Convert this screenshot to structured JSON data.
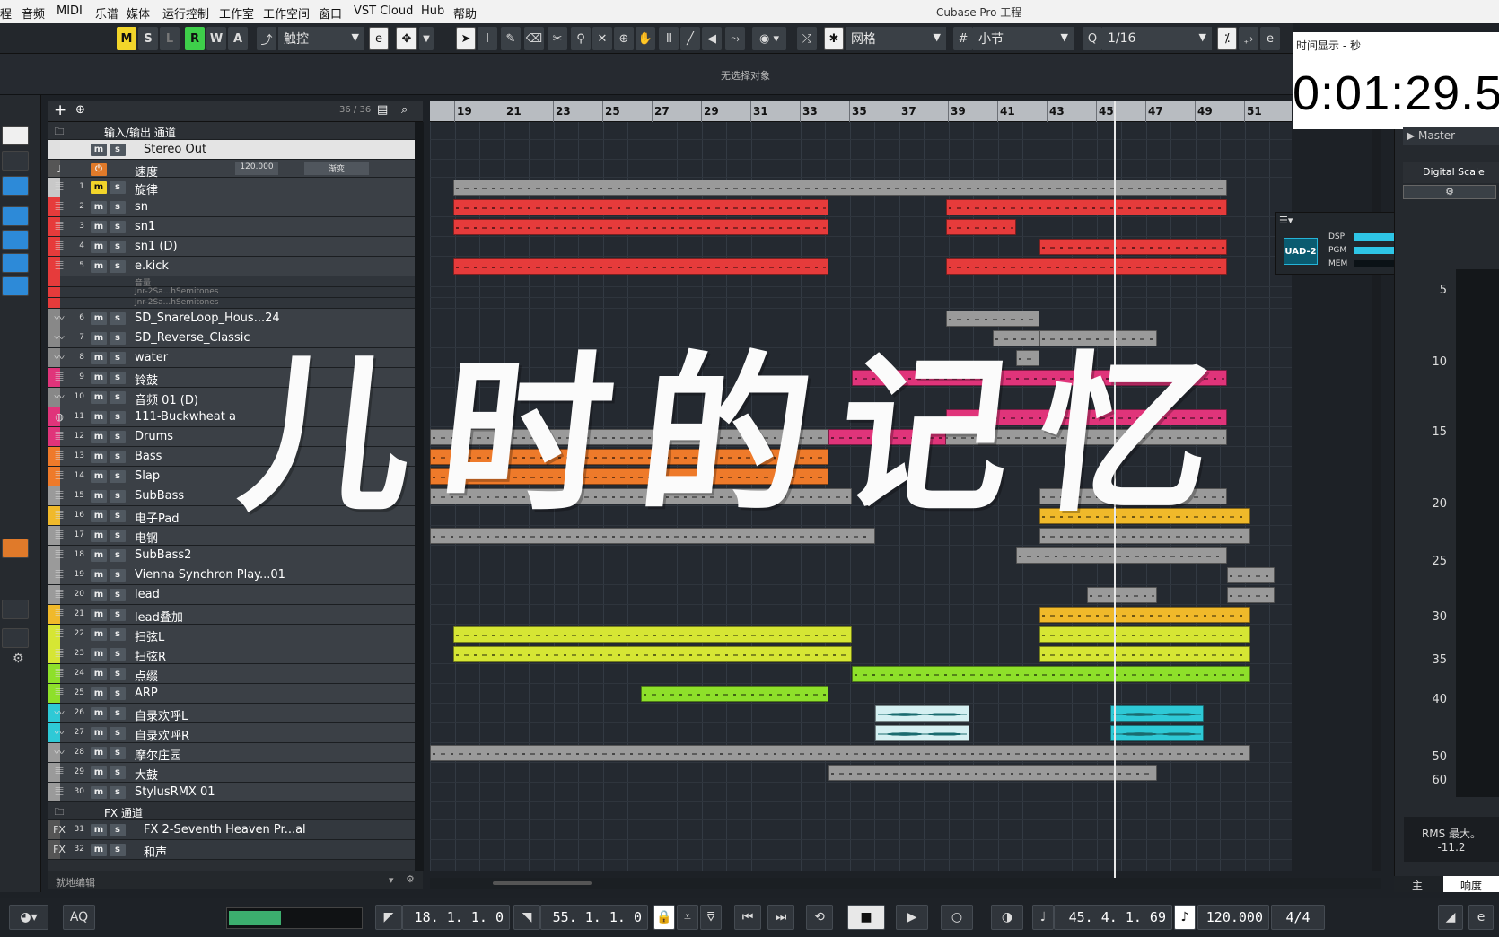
{
  "menu": [
    "程",
    "音频",
    "MIDI",
    "乐谱",
    "媒体",
    "运行控制",
    "工作室",
    "工作空间",
    "窗口",
    "VST Cloud",
    "Hub",
    "帮助"
  ],
  "app_title": "Cubase Pro 工程 -",
  "toolbar": {
    "mslrwa": [
      "M",
      "S",
      "L",
      "R",
      "W",
      "A"
    ],
    "automation_mode": "触控",
    "snap_type": "网格",
    "grid": "小节",
    "quantize": "1/16"
  },
  "info_line": "无选择对象",
  "tracklist": {
    "count": "36 / 36",
    "footer": "就地编辑",
    "tempo_value": "120.000",
    "tempo_mode": "渐变",
    "tracks": [
      {
        "num": "",
        "name": "输入/输出 通道",
        "type": "folder",
        "color": "#2c3035"
      },
      {
        "num": "",
        "name": "Stereo Out",
        "type": "output",
        "color": "#e0e0e0"
      },
      {
        "num": "",
        "name": "速度",
        "type": "tempo",
        "color": "#555"
      },
      {
        "num": "1",
        "name": "旋律",
        "type": "midi",
        "color": "#c8c8c8"
      },
      {
        "num": "2",
        "name": "sn",
        "type": "midi",
        "color": "#e63b3b"
      },
      {
        "num": "3",
        "name": "sn1",
        "type": "midi",
        "color": "#e63b3b"
      },
      {
        "num": "4",
        "name": "sn1 (D)",
        "type": "midi",
        "color": "#e63b3b"
      },
      {
        "num": "5",
        "name": "e.kick",
        "type": "midi",
        "color": "#e63b3b"
      },
      {
        "num": "",
        "name": "音量",
        "type": "auto",
        "color": "#e63b3b"
      },
      {
        "num": "",
        "name": "Jnr-2Sa...hSemitones",
        "type": "auto",
        "color": "#e63b3b"
      },
      {
        "num": "",
        "name": "Jnr-2Sa...hSemitones",
        "type": "auto",
        "color": "#e63b3b"
      },
      {
        "num": "6",
        "name": "SD_SnareLoop_Hous...24",
        "type": "audio",
        "color": "#888"
      },
      {
        "num": "7",
        "name": "SD_Reverse_Classic",
        "type": "audio",
        "color": "#888"
      },
      {
        "num": "8",
        "name": "water",
        "type": "audio",
        "color": "#888"
      },
      {
        "num": "9",
        "name": "铃鼓",
        "type": "midi",
        "color": "#e0347a"
      },
      {
        "num": "10",
        "name": "音频 01 (D)",
        "type": "audio",
        "color": "#888"
      },
      {
        "num": "11",
        "name": "111-Buckwheat a",
        "type": "drum",
        "color": "#e0347a"
      },
      {
        "num": "12",
        "name": "Drums",
        "type": "midi",
        "color": "#e0347a"
      },
      {
        "num": "13",
        "name": "Bass",
        "type": "midi",
        "color": "#ee7a2a"
      },
      {
        "num": "14",
        "name": "Slap",
        "type": "midi",
        "color": "#ee7a2a"
      },
      {
        "num": "15",
        "name": "SubBass",
        "type": "midi",
        "color": "#9a9a9a"
      },
      {
        "num": "16",
        "name": "电子Pad",
        "type": "midi",
        "color": "#f0b92a"
      },
      {
        "num": "17",
        "name": "电钢",
        "type": "midi",
        "color": "#9a9a9a"
      },
      {
        "num": "18",
        "name": "SubBass2",
        "type": "midi",
        "color": "#9a9a9a"
      },
      {
        "num": "19",
        "name": "Vienna Synchron Play...01",
        "type": "midi",
        "color": "#9a9a9a"
      },
      {
        "num": "20",
        "name": "lead",
        "type": "midi",
        "color": "#9a9a9a"
      },
      {
        "num": "21",
        "name": "lead叠加",
        "type": "midi",
        "color": "#f0b92a"
      },
      {
        "num": "22",
        "name": "扫弦L",
        "type": "midi",
        "color": "#d6e634"
      },
      {
        "num": "23",
        "name": "扫弦R",
        "type": "midi",
        "color": "#d6e634"
      },
      {
        "num": "24",
        "name": "点缀",
        "type": "midi",
        "color": "#8ee02a"
      },
      {
        "num": "25",
        "name": "ARP",
        "type": "midi",
        "color": "#8ee02a"
      },
      {
        "num": "26",
        "name": "自录欢呼L",
        "type": "audio",
        "color": "#2ec9d6"
      },
      {
        "num": "27",
        "name": "自录欢呼R",
        "type": "audio",
        "color": "#2ec9d6"
      },
      {
        "num": "28",
        "name": "摩尔庄园",
        "type": "audio",
        "color": "#9a9a9a"
      },
      {
        "num": "29",
        "name": "大鼓",
        "type": "midi",
        "color": "#9a9a9a"
      },
      {
        "num": "30",
        "name": "StylusRMX 01",
        "type": "midi",
        "color": "#9a9a9a"
      },
      {
        "num": "",
        "name": "FX 通道",
        "type": "folder",
        "color": "#2c3035"
      },
      {
        "num": "31",
        "name": "FX 2-Seventh Heaven Pr...al",
        "type": "fx",
        "color": "#555"
      },
      {
        "num": "32",
        "name": "和声",
        "type": "fx",
        "color": "#555"
      }
    ]
  },
  "ruler_bars": [
    "19",
    "21",
    "23",
    "25",
    "27",
    "29",
    "31",
    "33",
    "35",
    "37",
    "39",
    "41",
    "43",
    "45",
    "47",
    "49",
    "51"
  ],
  "time_display": {
    "caption": "时间显示 - 秒",
    "value": "0:01:29.5"
  },
  "right_panel": {
    "master": "Master",
    "scale_name": "Digital Scale",
    "scale_marks": [
      "5",
      "10",
      "15",
      "20",
      "25",
      "30",
      "35",
      "40",
      "50",
      "60"
    ],
    "rms_label": "RMS 最大。",
    "rms_value": "-11.2",
    "tabs": [
      "主",
      "响度"
    ]
  },
  "uad": {
    "logo": "UAD-2",
    "labels": [
      "DSP",
      "PGM",
      "MEM"
    ],
    "levels": [
      0.5,
      0.55,
      0
    ]
  },
  "transport": {
    "left_locator": "18. 1. 1.    0",
    "right_locator": "55. 1. 1.    0",
    "position": "45. 4. 1. 69",
    "tempo": "120.000",
    "signature": "4/4",
    "aq": "AQ"
  },
  "overlay_title": "儿时的记忆",
  "colors": {
    "red": "#e63b3b",
    "orange": "#ee7a2a",
    "pink": "#e0347a",
    "yellow": "#f0b92a",
    "lime": "#d6e634",
    "green": "#8ee02a",
    "cyan": "#2ec9d6",
    "grey": "#9a9a9a"
  }
}
